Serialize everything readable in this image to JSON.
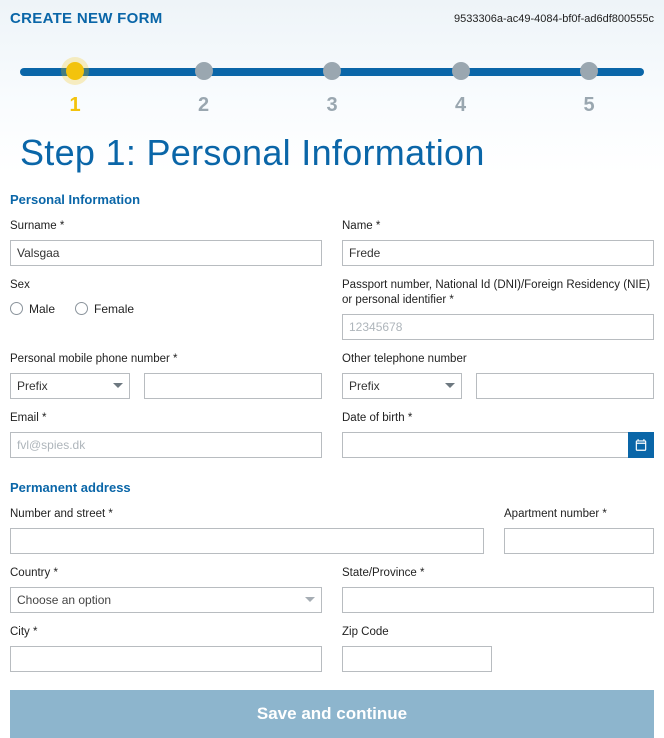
{
  "header": {
    "title": "CREATE NEW FORM",
    "uuid": "9533306a-ac49-4084-bf0f-ad6df800555c"
  },
  "progress": {
    "steps": [
      "1",
      "2",
      "3",
      "4",
      "5"
    ],
    "active": 0
  },
  "page_title": "Step 1: Personal Information",
  "sections": {
    "personal": {
      "heading": "Personal Information",
      "surname_label": "Surname *",
      "surname_value": "Valsgaa",
      "name_label": "Name *",
      "name_value": "Frede",
      "sex_label": "Sex",
      "sex_options": {
        "male": "Male",
        "female": "Female"
      },
      "passport_label": "Passport number, National Id (DNI)/Foreign Residency (NIE) or personal identifier *",
      "passport_placeholder": "12345678",
      "mobile_label": "Personal mobile phone number *",
      "other_tel_label": "Other telephone number",
      "prefix_text": "Prefix",
      "email_label": "Email *",
      "email_placeholder": "fvl@spies.dk",
      "dob_label": "Date of birth *"
    },
    "address": {
      "heading": "Permanent address",
      "street_label": "Number and street *",
      "apt_label": "Apartment number *",
      "country_label": "Country *",
      "country_placeholder": "Choose an option",
      "state_label": "State/Province *",
      "city_label": "City *",
      "zip_label": "Zip Code"
    }
  },
  "actions": {
    "save": "Save and continue"
  }
}
